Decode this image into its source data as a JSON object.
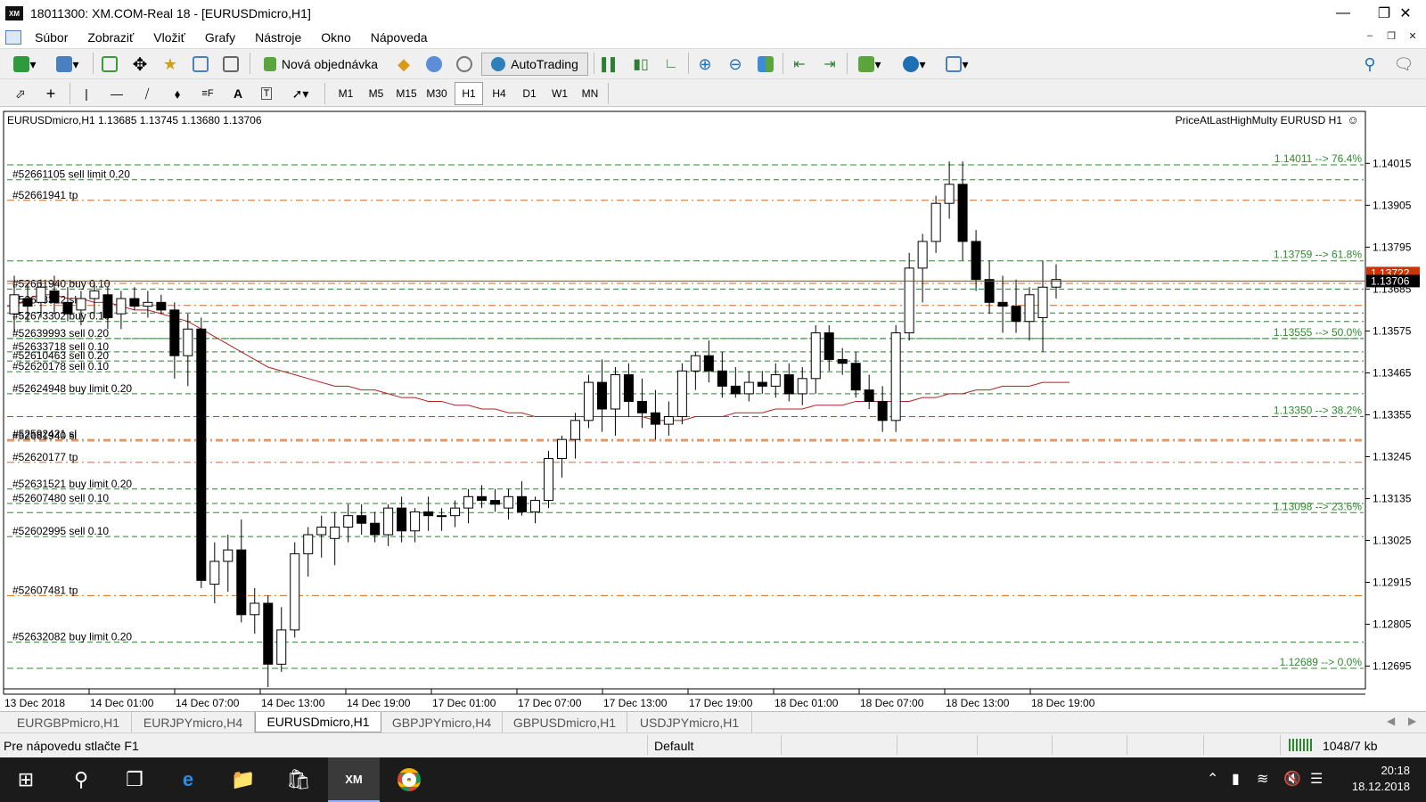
{
  "window": {
    "title": "18011300: XM.COM-Real 18 - [EURUSDmicro,H1]",
    "logo": "XM"
  },
  "menu": [
    "Súbor",
    "Zobraziť",
    "Vložiť",
    "Grafy",
    "Nástroje",
    "Okno",
    "Nápoveda"
  ],
  "toolbar": {
    "new_order_label": "Nová objednávka",
    "autotrading_label": "AutoTrading"
  },
  "timeframes": [
    "M1",
    "M5",
    "M15",
    "M30",
    "H1",
    "H4",
    "D1",
    "W1",
    "MN"
  ],
  "active_timeframe": "H1",
  "chart": {
    "header": "EURUSDmicro,H1  1.13685 1.13745 1.13680 1.13706",
    "indicator_label": "PriceAtLastHighMulty EURUSD H1",
    "bid_tag": "1.13706",
    "bid_tag_behind": "1.13722",
    "colors": {
      "bullish": "#ffffff",
      "bearish": "#000000",
      "ma": "#b22222",
      "fib": "#2e8b2e",
      "order": "#d2691e",
      "bid": "#cc3300"
    }
  },
  "chart_data": {
    "type": "candlestick",
    "symbol": "EURUSDmicro",
    "timeframe": "H1",
    "price_axis": {
      "range": [
        1.1264,
        1.141
      ],
      "ticks": [
        "1.14015",
        "1.13905",
        "1.13795",
        "1.13685",
        "1.13575",
        "1.13465",
        "1.13355",
        "1.13245",
        "1.13135",
        "1.13025",
        "1.12915",
        "1.12805",
        "1.12695"
      ]
    },
    "time_axis": {
      "ticks": [
        "13 Dec 2018",
        "14 Dec 01:00",
        "14 Dec 07:00",
        "14 Dec 13:00",
        "14 Dec 19:00",
        "17 Dec 01:00",
        "17 Dec 07:00",
        "17 Dec 13:00",
        "17 Dec 19:00",
        "18 Dec 01:00",
        "18 Dec 07:00",
        "18 Dec 13:00",
        "18 Dec 19:00"
      ]
    },
    "candles": [
      {
        "o": 1.1362,
        "h": 1.1372,
        "l": 1.1357,
        "c": 1.1367
      },
      {
        "o": 1.1366,
        "h": 1.137,
        "l": 1.136,
        "c": 1.1364
      },
      {
        "o": 1.1365,
        "h": 1.1371,
        "l": 1.1361,
        "c": 1.1369
      },
      {
        "o": 1.1368,
        "h": 1.1372,
        "l": 1.1362,
        "c": 1.1365
      },
      {
        "o": 1.1365,
        "h": 1.1369,
        "l": 1.136,
        "c": 1.1362
      },
      {
        "o": 1.1363,
        "h": 1.1368,
        "l": 1.1359,
        "c": 1.1366
      },
      {
        "o": 1.1366,
        "h": 1.137,
        "l": 1.1362,
        "c": 1.1368
      },
      {
        "o": 1.1367,
        "h": 1.1369,
        "l": 1.1358,
        "c": 1.1361
      },
      {
        "o": 1.1362,
        "h": 1.1368,
        "l": 1.1358,
        "c": 1.1366
      },
      {
        "o": 1.1366,
        "h": 1.1369,
        "l": 1.1363,
        "c": 1.1364
      },
      {
        "o": 1.1364,
        "h": 1.1368,
        "l": 1.1361,
        "c": 1.1365
      },
      {
        "o": 1.1365,
        "h": 1.1367,
        "l": 1.1362,
        "c": 1.1363
      },
      {
        "o": 1.1363,
        "h": 1.1365,
        "l": 1.1345,
        "c": 1.1351
      },
      {
        "o": 1.1351,
        "h": 1.1362,
        "l": 1.1343,
        "c": 1.1358
      },
      {
        "o": 1.1358,
        "h": 1.1361,
        "l": 1.129,
        "c": 1.1292
      },
      {
        "o": 1.1291,
        "h": 1.1302,
        "l": 1.1286,
        "c": 1.1297
      },
      {
        "o": 1.1297,
        "h": 1.1304,
        "l": 1.1289,
        "c": 1.13
      },
      {
        "o": 1.13,
        "h": 1.1308,
        "l": 1.1281,
        "c": 1.1283
      },
      {
        "o": 1.1283,
        "h": 1.129,
        "l": 1.1278,
        "c": 1.1286
      },
      {
        "o": 1.1286,
        "h": 1.1288,
        "l": 1.1264,
        "c": 1.127
      },
      {
        "o": 1.127,
        "h": 1.1285,
        "l": 1.1268,
        "c": 1.1279
      },
      {
        "o": 1.1279,
        "h": 1.1302,
        "l": 1.1277,
        "c": 1.1299
      },
      {
        "o": 1.1299,
        "h": 1.1306,
        "l": 1.1293,
        "c": 1.1304
      },
      {
        "o": 1.1304,
        "h": 1.1309,
        "l": 1.1298,
        "c": 1.1306
      },
      {
        "o": 1.1303,
        "h": 1.131,
        "l": 1.1296,
        "c": 1.1306
      },
      {
        "o": 1.1306,
        "h": 1.1312,
        "l": 1.1302,
        "c": 1.1309
      },
      {
        "o": 1.1309,
        "h": 1.1312,
        "l": 1.1304,
        "c": 1.1307
      },
      {
        "o": 1.1307,
        "h": 1.131,
        "l": 1.1302,
        "c": 1.1304
      },
      {
        "o": 1.1304,
        "h": 1.1312,
        "l": 1.1301,
        "c": 1.1311
      },
      {
        "o": 1.1311,
        "h": 1.1314,
        "l": 1.1302,
        "c": 1.1305
      },
      {
        "o": 1.1305,
        "h": 1.1311,
        "l": 1.1302,
        "c": 1.131
      },
      {
        "o": 1.131,
        "h": 1.1314,
        "l": 1.1305,
        "c": 1.1309
      },
      {
        "o": 1.1309,
        "h": 1.1311,
        "l": 1.1305,
        "c": 1.1309
      },
      {
        "o": 1.1309,
        "h": 1.1313,
        "l": 1.1306,
        "c": 1.1311
      },
      {
        "o": 1.1311,
        "h": 1.1316,
        "l": 1.1307,
        "c": 1.1314
      },
      {
        "o": 1.1314,
        "h": 1.1317,
        "l": 1.1311,
        "c": 1.1313
      },
      {
        "o": 1.1313,
        "h": 1.1316,
        "l": 1.131,
        "c": 1.1312
      },
      {
        "o": 1.1311,
        "h": 1.1316,
        "l": 1.1308,
        "c": 1.1314
      },
      {
        "o": 1.1314,
        "h": 1.1318,
        "l": 1.1309,
        "c": 1.131
      },
      {
        "o": 1.131,
        "h": 1.1314,
        "l": 1.1307,
        "c": 1.1313
      },
      {
        "o": 1.1313,
        "h": 1.1326,
        "l": 1.1311,
        "c": 1.1324
      },
      {
        "o": 1.1324,
        "h": 1.133,
        "l": 1.1319,
        "c": 1.1329
      },
      {
        "o": 1.1329,
        "h": 1.1336,
        "l": 1.1324,
        "c": 1.1334
      },
      {
        "o": 1.1334,
        "h": 1.1346,
        "l": 1.1332,
        "c": 1.1344
      },
      {
        "o": 1.1344,
        "h": 1.135,
        "l": 1.1331,
        "c": 1.1337
      },
      {
        "o": 1.1337,
        "h": 1.1348,
        "l": 1.133,
        "c": 1.1346
      },
      {
        "o": 1.1346,
        "h": 1.1349,
        "l": 1.1335,
        "c": 1.1339
      },
      {
        "o": 1.1339,
        "h": 1.1345,
        "l": 1.1332,
        "c": 1.1336
      },
      {
        "o": 1.1336,
        "h": 1.1342,
        "l": 1.1329,
        "c": 1.1333
      },
      {
        "o": 1.1333,
        "h": 1.1339,
        "l": 1.133,
        "c": 1.1335
      },
      {
        "o": 1.1335,
        "h": 1.1349,
        "l": 1.1333,
        "c": 1.1347
      },
      {
        "o": 1.1347,
        "h": 1.1352,
        "l": 1.1342,
        "c": 1.1351
      },
      {
        "o": 1.1351,
        "h": 1.1355,
        "l": 1.1344,
        "c": 1.1347
      },
      {
        "o": 1.1347,
        "h": 1.1352,
        "l": 1.134,
        "c": 1.1343
      },
      {
        "o": 1.1343,
        "h": 1.1348,
        "l": 1.134,
        "c": 1.1341
      },
      {
        "o": 1.1341,
        "h": 1.1347,
        "l": 1.1339,
        "c": 1.1344
      },
      {
        "o": 1.1344,
        "h": 1.1347,
        "l": 1.1341,
        "c": 1.1343
      },
      {
        "o": 1.1343,
        "h": 1.1349,
        "l": 1.134,
        "c": 1.1346
      },
      {
        "o": 1.1346,
        "h": 1.1349,
        "l": 1.1339,
        "c": 1.1341
      },
      {
        "o": 1.1341,
        "h": 1.1348,
        "l": 1.1338,
        "c": 1.1345
      },
      {
        "o": 1.1345,
        "h": 1.1359,
        "l": 1.1341,
        "c": 1.1357
      },
      {
        "o": 1.1357,
        "h": 1.1359,
        "l": 1.1347,
        "c": 1.135
      },
      {
        "o": 1.135,
        "h": 1.1353,
        "l": 1.1346,
        "c": 1.1349
      },
      {
        "o": 1.1349,
        "h": 1.1352,
        "l": 1.134,
        "c": 1.1342
      },
      {
        "o": 1.1342,
        "h": 1.1346,
        "l": 1.1337,
        "c": 1.1339
      },
      {
        "o": 1.1339,
        "h": 1.1343,
        "l": 1.1331,
        "c": 1.1334
      },
      {
        "o": 1.1334,
        "h": 1.1359,
        "l": 1.1331,
        "c": 1.1357
      },
      {
        "o": 1.1357,
        "h": 1.1378,
        "l": 1.1355,
        "c": 1.1374
      },
      {
        "o": 1.1374,
        "h": 1.1383,
        "l": 1.1365,
        "c": 1.1381
      },
      {
        "o": 1.1381,
        "h": 1.1393,
        "l": 1.1378,
        "c": 1.1391
      },
      {
        "o": 1.1391,
        "h": 1.1402,
        "l": 1.1387,
        "c": 1.1396
      },
      {
        "o": 1.1396,
        "h": 1.1402,
        "l": 1.1376,
        "c": 1.1381
      },
      {
        "o": 1.1381,
        "h": 1.1384,
        "l": 1.1368,
        "c": 1.1371
      },
      {
        "o": 1.1371,
        "h": 1.1376,
        "l": 1.1362,
        "c": 1.1365
      },
      {
        "o": 1.1365,
        "h": 1.1372,
        "l": 1.1357,
        "c": 1.1364
      },
      {
        "o": 1.1364,
        "h": 1.1371,
        "l": 1.1357,
        "c": 1.136
      },
      {
        "o": 1.136,
        "h": 1.1369,
        "l": 1.1355,
        "c": 1.1367
      },
      {
        "o": 1.1361,
        "h": 1.1376,
        "l": 1.1352,
        "c": 1.1369
      },
      {
        "o": 1.1369,
        "h": 1.1375,
        "l": 1.1366,
        "c": 1.1371
      }
    ],
    "moving_average": [
      1.1364,
      1.1366,
      1.1367,
      1.1367,
      1.1366,
      1.1366,
      1.1365,
      1.1365,
      1.1364,
      1.1363,
      1.1363,
      1.1362,
      1.1361,
      1.136,
      1.1358,
      1.1356,
      1.1354,
      1.1352,
      1.135,
      1.1348,
      1.1347,
      1.1346,
      1.1345,
      1.1344,
      1.1343,
      1.1343,
      1.1342,
      1.1342,
      1.1341,
      1.134,
      1.134,
      1.1339,
      1.1339,
      1.1338,
      1.1338,
      1.1337,
      1.1337,
      1.1336,
      1.1336,
      1.1335,
      1.1335,
      1.1335,
      1.1335,
      1.1335,
      1.1335,
      1.1335,
      1.1335,
      1.1335,
      1.1334,
      1.1334,
      1.1334,
      1.1335,
      1.1335,
      1.1335,
      1.1336,
      1.1336,
      1.1336,
      1.1337,
      1.1337,
      1.1337,
      1.1338,
      1.1338,
      1.1338,
      1.1339,
      1.1339,
      1.1339,
      1.1339,
      1.1339,
      1.134,
      1.134,
      1.1341,
      1.1341,
      1.1342,
      1.1342,
      1.1343,
      1.1343,
      1.1343,
      1.1344,
      1.1344,
      1.1344
    ],
    "fib_levels": [
      {
        "price": 1.14011,
        "label": "1.14011 --> 76.4%"
      },
      {
        "price": 1.13759,
        "label": "1.13759 --> 61.8%"
      },
      {
        "price": 1.13555,
        "label": "1.13555 --> 50.0%"
      },
      {
        "price": 1.1335,
        "label": "1.13350 --> 38.2%"
      },
      {
        "price": 1.13098,
        "label": "1.13098 --> 23.6%"
      },
      {
        "price": 1.12689,
        "label": "1.12689 --> 0.0%"
      }
    ],
    "order_lines": [
      {
        "price": 1.13972,
        "label": "#52661105 sell limit 0.20",
        "kind": "entry"
      },
      {
        "price": 1.13918,
        "label": "#52661941 tp",
        "kind": "exit"
      },
      {
        "price": 1.137,
        "label": "",
        "kind": "exit"
      },
      {
        "price": 1.13685,
        "label": "#52661940 buy 0.10",
        "kind": "entry"
      },
      {
        "price": 1.13642,
        "label": "#52673312 sl",
        "kind": "exit"
      },
      {
        "price": 1.13622,
        "label": "",
        "kind": "entry"
      },
      {
        "price": 1.136,
        "label": "#52673302 buy 0.10",
        "kind": "entry"
      },
      {
        "price": 1.13555,
        "label": "#52639993 sell 0.20",
        "kind": "entry"
      },
      {
        "price": 1.1352,
        "label": "#52633718 sell 0.10",
        "kind": "entry"
      },
      {
        "price": 1.13496,
        "label": "#52610463 sell 0.20",
        "kind": "entry"
      },
      {
        "price": 1.13468,
        "label": "#52620178 sell 0.10",
        "kind": "entry"
      },
      {
        "price": 1.1341,
        "label": "#52624948 buy limit 0.20",
        "kind": "entry"
      },
      {
        "price": 1.1329,
        "label": "#52592421 sl",
        "kind": "exit"
      },
      {
        "price": 1.13286,
        "label": "#52661940 sl",
        "kind": "exit"
      },
      {
        "price": 1.1323,
        "label": "#52620177 tp",
        "kind": "exit"
      },
      {
        "price": 1.1316,
        "label": "#52631521 buy limit 0.20",
        "kind": "entry"
      },
      {
        "price": 1.13122,
        "label": "#52607480 sell 0.10",
        "kind": "entry"
      },
      {
        "price": 1.13035,
        "label": "#52602995 sell 0.10",
        "kind": "entry"
      },
      {
        "price": 1.1288,
        "label": "#52607481 tp",
        "kind": "exit"
      },
      {
        "price": 1.12758,
        "label": "#52632082 buy limit 0.20",
        "kind": "entry"
      }
    ],
    "bid": 1.13706
  },
  "tabs": [
    "EURGBPmicro,H1",
    "EURJPYmicro,H4",
    "EURUSDmicro,H1",
    "GBPJPYmicro,H4",
    "GBPUSDmicro,H1",
    "USDJPYmicro,H1"
  ],
  "active_tab": "EURUSDmicro,H1",
  "status": {
    "hint": "Pre nápovedu stlačte F1",
    "profile": "Default",
    "connection": "1048/7 kb"
  },
  "taskbar": {
    "time": "20:18",
    "date": "18.12.2018"
  }
}
